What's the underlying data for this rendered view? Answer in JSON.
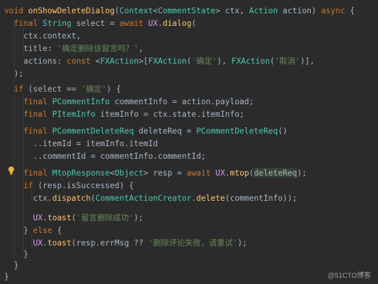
{
  "code": {
    "l1": {
      "kw_void": "void",
      "fn_name": "onShowDeleteDialog",
      "p1": "(",
      "ty_ctx": "Context",
      "lt": "<",
      "ty_cs": "CommentState",
      "gt": ">",
      "p2": " ctx, ",
      "ty_action": "Action",
      "p3": " action) ",
      "kw_async": "async",
      "p4": " {"
    },
    "l2": {
      "indent": "  ",
      "kw_final": "final",
      "sp": " ",
      "ty_string": "String",
      "p1": " select = ",
      "kw_await": "await",
      "p2": " ",
      "cls_ux": "UX",
      "p3": ".",
      "fn_dialog": "dialog",
      "p4": "("
    },
    "l3": {
      "indent": "    ",
      "text": "ctx.context,"
    },
    "l4": {
      "indent": "    ",
      "key": "title: ",
      "str": "'确定删除该留言吗？'",
      "p": ","
    },
    "l5": {
      "indent": "    ",
      "key": "actions: ",
      "kw_const": "const",
      "p1": " <",
      "ty_fx": "FXAction",
      "p2": ">[",
      "fn_fx1": "FXAction",
      "p3": "(",
      "str1": "'确定'",
      "p4": "), ",
      "fn_fx2": "FXAction",
      "p5": "(",
      "str2": "'取消'",
      "p6": ")],"
    },
    "l6": {
      "indent": "  ",
      "text": ");"
    },
    "l8": {
      "indent": "  ",
      "kw_if": "if",
      "p1": " (select == ",
      "str": "'确定'",
      "p2": ") {"
    },
    "l9": {
      "indent": "    ",
      "kw_final": "final",
      "sp": " ",
      "ty": "PCommentInfo",
      "p": " commentInfo = action.payload;"
    },
    "l10": {
      "indent": "    ",
      "kw_final": "final",
      "sp": " ",
      "ty": "PItemInfo",
      "p": " itemInfo = ctx.state.itemInfo;"
    },
    "l12": {
      "indent": "    ",
      "kw_final": "final",
      "sp": " ",
      "ty": "PCommentDeleteReq",
      "p1": " deleteReq = ",
      "fn": "PCommentDeleteReq",
      "p2": "()"
    },
    "l13": {
      "indent": "      ",
      "text": "..itemId = itemInfo.itemId"
    },
    "l14": {
      "indent": "      ",
      "text": "..commentId = commentInfo.commentId;"
    },
    "l16": {
      "indent": "    ",
      "kw_final": "final",
      "sp": " ",
      "ty": "MtopResponse",
      "lt": "<",
      "ty_obj": "Object",
      "gt": ">",
      "p1": " resp = ",
      "kw_await": "await",
      "p2": " ",
      "cls_ux": "UX",
      "p3": ".",
      "fn_mtop": "mtop",
      "p4": "(",
      "hl": "deleteReq",
      "p5": ");"
    },
    "l17": {
      "indent": "    ",
      "kw_if": "if",
      "p": " (resp.isSuccessed) {"
    },
    "l18": {
      "indent": "      ",
      "text1": "ctx.",
      "fn_dispatch": "dispatch",
      "p1": "(",
      "cls_cac": "CommentActionCreator",
      "p2": ".",
      "fn_delete": "delete",
      "p3": "(commentInfo));"
    },
    "l20": {
      "indent": "      ",
      "cls_ux": "UX",
      "p1": ".",
      "fn_toast": "toast",
      "p2": "(",
      "str": "'留言删除成功'",
      "p3": ");"
    },
    "l21": {
      "indent": "    ",
      "p1": "} ",
      "kw_else": "else",
      "p2": " {"
    },
    "l22": {
      "indent": "      ",
      "cls_ux": "UX",
      "p1": ".",
      "fn_toast": "toast",
      "p2": "(resp.errMsg ?? ",
      "str": "'删除评论失败，请重试'",
      "p3": ");"
    },
    "l23": {
      "indent": "    ",
      "text": "}"
    },
    "l24": {
      "indent": "  ",
      "text": "}"
    },
    "l25": {
      "indent": "",
      "text": "}"
    }
  },
  "gutter": {
    "bulb_icon": "lightbulb-icon"
  },
  "watermark": "@51CTO博客",
  "colors": {
    "background": "#2b2b2b",
    "keyword": "#cc7832",
    "type": "#4ec9b0",
    "string": "#6a8759",
    "function": "#ffc66d",
    "class": "#d59ee8"
  }
}
